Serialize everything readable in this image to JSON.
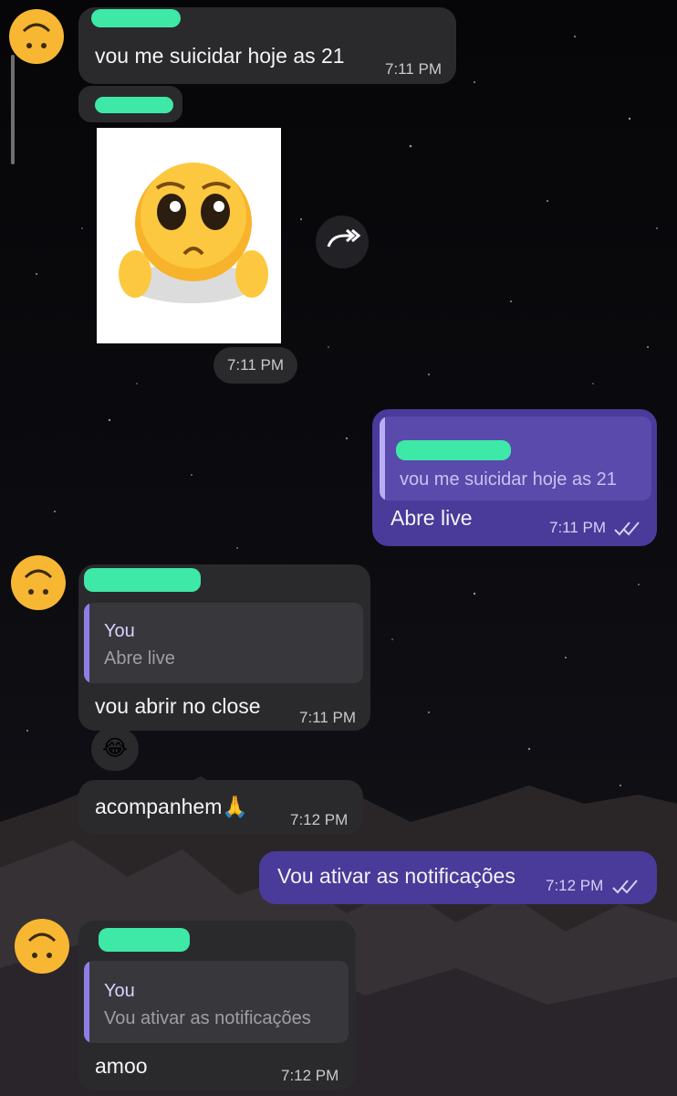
{
  "messages": {
    "m1": {
      "text": "vou me suicidar hoje as 21",
      "time": "7:11 PM"
    },
    "m2": {
      "time": "7:11 PM",
      "sticker": "pleading-face-sticker",
      "forward_icon": "forward-icon"
    },
    "m3": {
      "reply_text": "vou me suicidar hoje as 21",
      "text": "Abre live",
      "time": "7:11 PM",
      "status": "read-checks"
    },
    "m4": {
      "reply_name": "You",
      "reply_text": "Abre live",
      "text": "vou abrir no close",
      "time": "7:11 PM",
      "reaction": "😂"
    },
    "m5": {
      "text": "acompanhem🙏",
      "time": "7:12 PM"
    },
    "m6": {
      "text": "Vou ativar as notificações",
      "time": "7:12 PM",
      "status": "read-checks"
    },
    "m7": {
      "reply_name": "You",
      "reply_text": "Vou ativar as notificações",
      "text": "amoo",
      "time": "7:12 PM"
    }
  },
  "colors": {
    "incoming_bubble": "#2a2a2d",
    "outgoing_bubble": "#4a3a9a",
    "redaction_marker": "#3ee8a6",
    "avatar": "#f7b733"
  }
}
